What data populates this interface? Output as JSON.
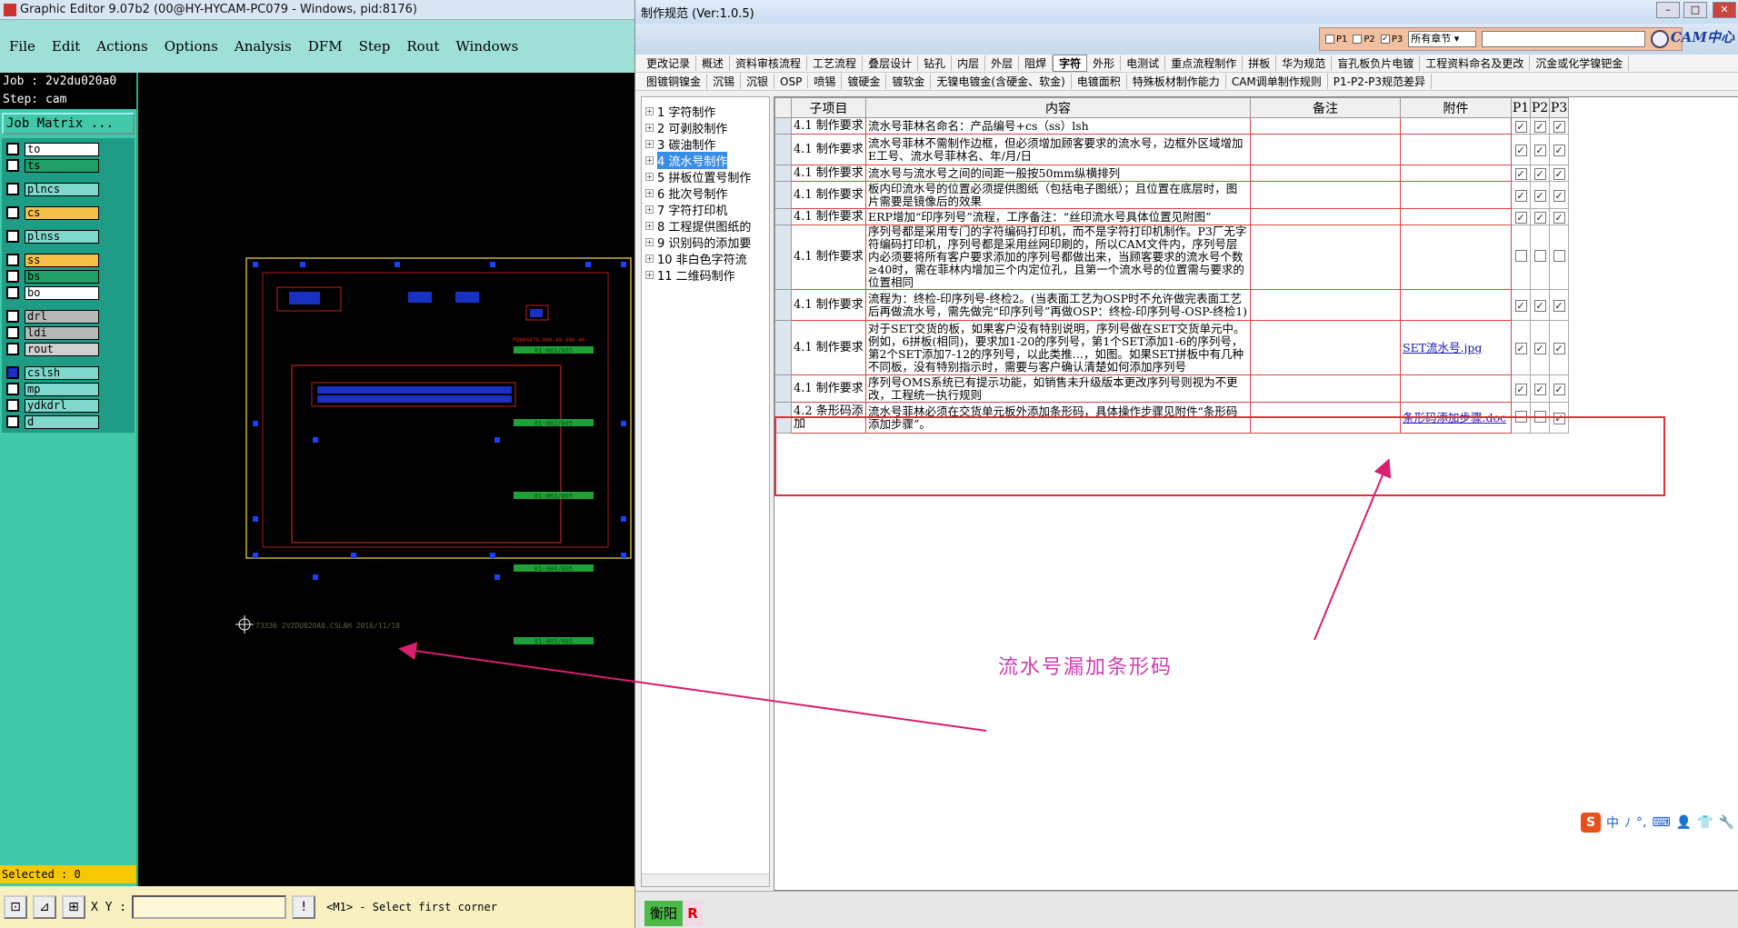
{
  "graphic_editor": {
    "title": "Graphic Editor 9.07b2 (00@HY-HYCAM-PC079 - Windows, pid:8176)",
    "menu": [
      "File",
      "Edit",
      "Actions",
      "Options",
      "Analysis",
      "DFM",
      "Step",
      "Rout",
      "Windows"
    ],
    "job": "Job : 2v2du020a0",
    "step": "Step: cam",
    "job_matrix": "Job Matrix ...",
    "layers": [
      {
        "name": "to",
        "color": "#ffffff"
      },
      {
        "name": "ts",
        "color": "#1fa068"
      },
      {
        "name": "",
        "color": "gap"
      },
      {
        "name": "plncs",
        "color": "#7fd8cc"
      },
      {
        "name": "",
        "color": "gap"
      },
      {
        "name": "cs",
        "color": "#f5c04a"
      },
      {
        "name": "",
        "color": "gap"
      },
      {
        "name": "plnss",
        "color": "#7fd8cc"
      },
      {
        "name": "",
        "color": "gap"
      },
      {
        "name": "ss",
        "color": "#f5c04a"
      },
      {
        "name": "bs",
        "color": "#1fa068"
      },
      {
        "name": "bo",
        "color": "#ffffff"
      },
      {
        "name": "",
        "color": "gap"
      },
      {
        "name": "drl",
        "color": "#b8b8b8"
      },
      {
        "name": "ldi",
        "color": "#b8b8b8"
      },
      {
        "name": "rout",
        "color": "#d0d0d0"
      },
      {
        "name": "",
        "color": "gap"
      },
      {
        "name": "cslsh",
        "color": "#7fd8cc"
      },
      {
        "name": "mp",
        "color": "#7fd8cc"
      },
      {
        "name": "ydkdrl",
        "color": "#7fd8cc"
      },
      {
        "name": "d",
        "color": "#7fd8cc"
      }
    ],
    "selected": "Selected : 0",
    "xy_label": "X Y :",
    "status_msg": "<M1> - Select first corner",
    "canvas_labels": {
      "codes": [
        "01-001/005",
        "01-002/005",
        "01-003/005",
        "01-004/005",
        "01-005/005"
      ],
      "bottom": "73336 2V2DU020A0.CSLAH 2016/11/18",
      "part": "PDB0047B-008-A0-SB0-00"
    }
  },
  "spec": {
    "title": "制作规范 (Ver:1.0.5)",
    "filters": [
      "P1",
      "P2",
      "P3"
    ],
    "chapter": "所有章节",
    "logo": "CAM中心",
    "tabs_row1": [
      "更改记录",
      "概述",
      "资料审核流程",
      "工艺流程",
      "叠层设计",
      "钻孔",
      "内层",
      "外层",
      "阻焊",
      "字符",
      "外形",
      "电测试",
      "重点流程制作",
      "拼板",
      "华为规范",
      "盲孔板负片电镀",
      "工程资料命名及更改",
      "沉金或化学镍钯金"
    ],
    "tabs_row2": [
      "图镀铜镍金",
      "沉锡",
      "沉银",
      "OSP",
      "喷锡",
      "镀硬金",
      "镀软金",
      "无镍电镀金(含硬金、软金)",
      "电镀面积",
      "特殊板材制作能力",
      "CAM调单制作规则",
      "P1-P2-P3规范差异"
    ],
    "active_tab": "字符",
    "tree": [
      "1 字符制作",
      "2 可剥胶制作",
      "3 碳油制作",
      "4 流水号制作",
      "5 拼板位置号制作",
      "6 批次号制作",
      "7 字符打印机",
      "8 工程提供图纸的",
      "9 识别码的添加要",
      "10 非白色字符流",
      "11 二维码制作"
    ],
    "tree_selected": 3,
    "columns": [
      "子项目",
      "内容",
      "备注",
      "附件",
      "P1",
      "P2",
      "P3"
    ],
    "rows": [
      {
        "sub": "4.1 制作要求",
        "content": "流水号菲林名命名：产品编号+cs（ss）lsh",
        "note": "",
        "att": "",
        "p": [
          "✓",
          "✓",
          "✓"
        ]
      },
      {
        "sub": "4.1 制作要求",
        "content": "流水号菲林不需制作边框，但必须增加顾客要求的流水号，边框外区域增加E工号、流水号菲林名、年/月/日",
        "note": "",
        "att": "",
        "p": [
          "✓",
          "✓",
          "✓"
        ]
      },
      {
        "sub": "4.1 制作要求",
        "content": "流水号与流水号之间的间距一般按50mm纵横排列",
        "note": "",
        "att": "",
        "p": [
          "✓",
          "✓",
          "✓"
        ]
      },
      {
        "sub": "4.1 制作要求",
        "content": "板内印流水号的位置必须提供图纸（包括电子图纸）；且位置在底层时，图片需要是镜像后的效果",
        "note": "",
        "att": "",
        "p": [
          "✓",
          "✓",
          "✓"
        ]
      },
      {
        "sub": "4.1 制作要求",
        "content": "ERP增加“印序列号”流程，工序备注：“丝印流水号具体位置见附图”",
        "note": "",
        "att": "",
        "p": [
          "✓",
          "✓",
          "✓"
        ]
      },
      {
        "sub": "4.1 制作要求",
        "content": "序列号都是采用专门的字符编码打印机，而不是字符打印机制作。P3厂无字符编码打印机，序列号都是采用丝网印刷的，所以CAM文件内，序列号层内必须要将所有客户要求添加的序列号都做出来，当顾客要求的流水号个数≥40时，需在菲林内增加三个内定位孔，且第一个流水号的位置需与要求的位置相同",
        "note": "",
        "att": "",
        "p": [
          "",
          "",
          ""
        ]
      },
      {
        "sub": "4.1 制作要求",
        "content": "流程为：终检-印序列号-终检2。(当表面工艺为OSP时不允许做完表面工艺后再做流水号，需先做完“印序列号”再做OSP：终检-印序列号-OSP-终检1)",
        "note": "",
        "att": "",
        "p": [
          "✓",
          "✓",
          "✓"
        ]
      },
      {
        "sub": "4.1 制作要求",
        "content": "对于SET交货的板，如果客户没有特别说明，序列号做在SET交货单元中。例如，6拼板(相同)，要求加1-20的序列号，第1个SET添加1-6的序列号，第2个SET添加7-12的序列号，以此类推…，如图。如果SET拼板中有几种不同板，没有特别指示时，需要与客户确认清楚如何添加序列号",
        "note": "",
        "att": "SET流水号.jpg",
        "p": [
          "✓",
          "✓",
          "✓"
        ]
      },
      {
        "sub": "4.1 制作要求",
        "content": "序列号OMS系统已有提示功能，如销售未升级版本更改序列号则视为不更改，工程统一执行规则",
        "note": "",
        "att": "",
        "p": [
          "✓",
          "✓",
          "✓"
        ]
      },
      {
        "sub": "4.2 条形码添加",
        "content": "流水号菲林必须在交货单元板外添加条形码，具体操作步骤见附件“条形码添加步骤”。",
        "note": "",
        "att": "条形码添加步骤.doc",
        "p": [
          "",
          "",
          "✓"
        ]
      }
    ],
    "annotation": "流水号漏加条形码",
    "ime": [
      "中",
      "ﾉ",
      "°,",
      "⌨",
      "👤",
      "👕",
      "🔧"
    ],
    "footer_tab": "衡阳",
    "footer_r": "R"
  }
}
